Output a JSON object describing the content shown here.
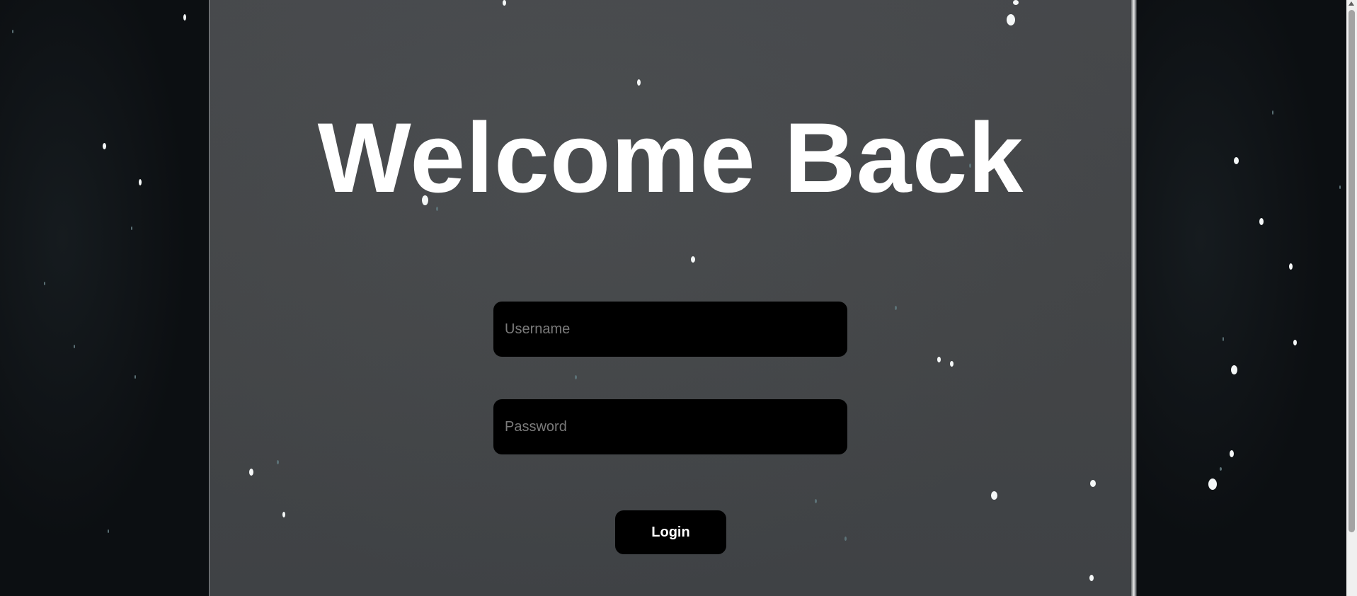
{
  "login": {
    "title": "Welcome Back",
    "username_placeholder": "Username",
    "password_placeholder": "Password",
    "login_label": "Login"
  },
  "theme": {
    "field_background": "#000000",
    "panel_background": "#444649",
    "outer_background": "#0e1115",
    "text_color": "#ffffff"
  }
}
